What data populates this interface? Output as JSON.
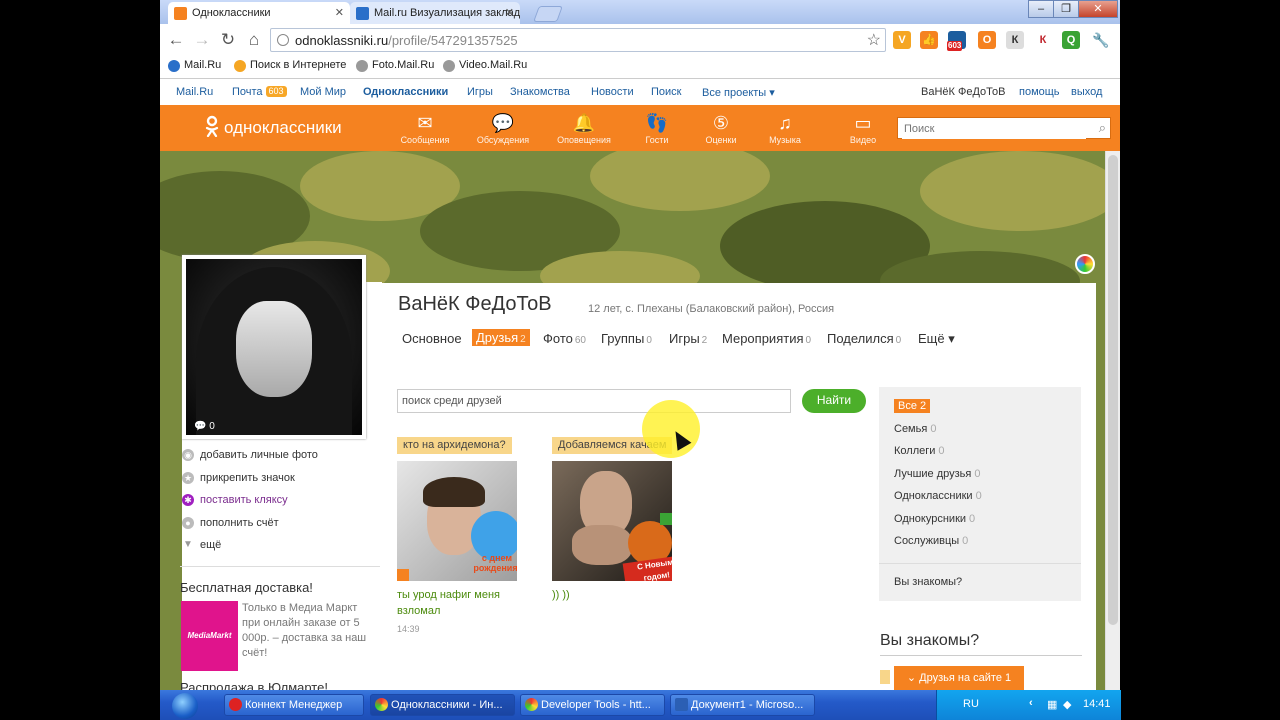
{
  "browser": {
    "tabs": [
      {
        "label": "Одноклассники",
        "active": true
      },
      {
        "label": "Mail.ru Визуализация заклад",
        "active": false
      }
    ],
    "url": "odnoklassniki.ru",
    "url_path": "/profile/547291357525",
    "ext_badge": "603",
    "bookmarks": [
      "Mail.Ru",
      "Поиск в Интернете",
      "Foto.Mail.Ru",
      "Video.Mail.Ru"
    ]
  },
  "portal_nav": {
    "links": [
      "Mail.Ru",
      "Почта",
      "Мой Мир",
      "Одноклассники",
      "Игры",
      "Знакомства",
      "Новости",
      "Поиск",
      "Все проекты ▾"
    ],
    "mail_count": "603",
    "user": "ВаНёК ФеДоТоВ",
    "help": "помощь",
    "logout": "выход"
  },
  "ok_bar": {
    "logo": "одноклассники",
    "items": [
      "Сообщения",
      "Обсуждения",
      "Оповещения",
      "Гости",
      "Оценки",
      "Музыка",
      "Видео"
    ],
    "search_placeholder": "Поиск"
  },
  "profile": {
    "name": "ВаНёК ФеДоТоВ",
    "info": "12 лет, с. Плеханы (Балаковский район), Россия",
    "avatar_comments": "0",
    "tabs": [
      {
        "label": "Основное",
        "count": ""
      },
      {
        "label": "Друзья",
        "count": "2"
      },
      {
        "label": "Фото",
        "count": "60"
      },
      {
        "label": "Группы",
        "count": "0"
      },
      {
        "label": "Игры",
        "count": "2"
      },
      {
        "label": "Мероприятия",
        "count": "0"
      },
      {
        "label": "Поделился",
        "count": "0"
      },
      {
        "label": "Ещё ▾",
        "count": ""
      }
    ],
    "actions": [
      "добавить личные фото",
      "прикрепить значок",
      "поставить кляксу",
      "пополнить счёт",
      "ещё"
    ]
  },
  "friends": {
    "search_value": "поиск среди друзей",
    "find_button": "Найти",
    "cards": [
      {
        "status": "кто на архидемона?",
        "name_line1": "ты урод нафиг меня",
        "name_line2": "взломал",
        "time": "14:39",
        "photo_text": "с днем рождения!"
      },
      {
        "status": "Добавляемся качаем",
        "name_line1": ")) ))",
        "name_line2": "",
        "time": "",
        "photo_text": "С Новым годом!"
      }
    ]
  },
  "filter": {
    "items": [
      {
        "label": "Все",
        "count": "2"
      },
      {
        "label": "Семья",
        "count": "0"
      },
      {
        "label": "Коллеги",
        "count": "0"
      },
      {
        "label": "Лучшие друзья",
        "count": "0"
      },
      {
        "label": "Одноклассники",
        "count": "0"
      },
      {
        "label": "Однокурсники",
        "count": "0"
      },
      {
        "label": "Сослуживцы",
        "count": "0"
      }
    ],
    "know_link": "Вы знакомы?"
  },
  "know_title": "Вы знакомы?",
  "friends_online_button": "Друзья на сайте 1",
  "promo": {
    "title": "Бесплатная доставка!",
    "logo": "MediaMarkt",
    "text": "Только в Медиа Маркт при онлайн заказе от 5 000р. – доставка за наш счёт!",
    "title2": "Распродажа в Юлмарте!"
  },
  "taskbar": {
    "tasks": [
      "Коннект Менеджер",
      "Одноклассники - Ин...",
      "Developer Tools - htt...",
      "Документ1 - Microso..."
    ],
    "lang": "RU",
    "clock": "14:41"
  },
  "colors": {
    "ok_orange": "#f58220",
    "link_blue": "#1c5d9e",
    "green": "#4caf2a"
  }
}
